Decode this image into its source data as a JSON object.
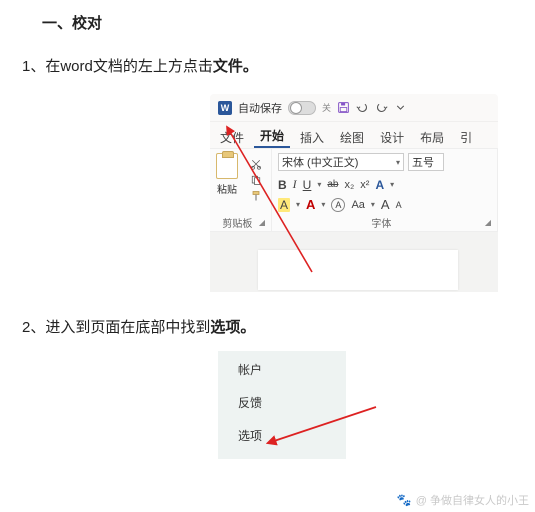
{
  "doc": {
    "heading": "一、校对",
    "step1_prefix": "1、在word文档的左上方点击",
    "step1_bold": "文件。",
    "step2_prefix": "2、进入到页面在底部中找到",
    "step2_bold": "选项。"
  },
  "word": {
    "logo": "W",
    "autosave_label": "自动保存",
    "autosave_off": "关",
    "tabs": {
      "file": "文件",
      "home": "开始",
      "insert": "插入",
      "draw": "绘图",
      "design": "设计",
      "layout": "布局",
      "ref": "引"
    },
    "clipboard": {
      "paste": "粘贴",
      "group": "剪贴板"
    },
    "font": {
      "name": "宋体 (中文正文)",
      "size": "五号",
      "group": "字体",
      "b": "B",
      "i": "I",
      "u": "U",
      "strike": "ab",
      "sub": "x₂",
      "sup": "x²",
      "shade": "A",
      "clear": "A",
      "color_a": "A",
      "circle_a": "A",
      "aa": "Aa",
      "grow": "A",
      "shrink": "A"
    }
  },
  "menu": {
    "account": "帐户",
    "feedback": "反馈",
    "options": "选项"
  },
  "watermark": {
    "text": "@ 争做自律女人的小王"
  }
}
